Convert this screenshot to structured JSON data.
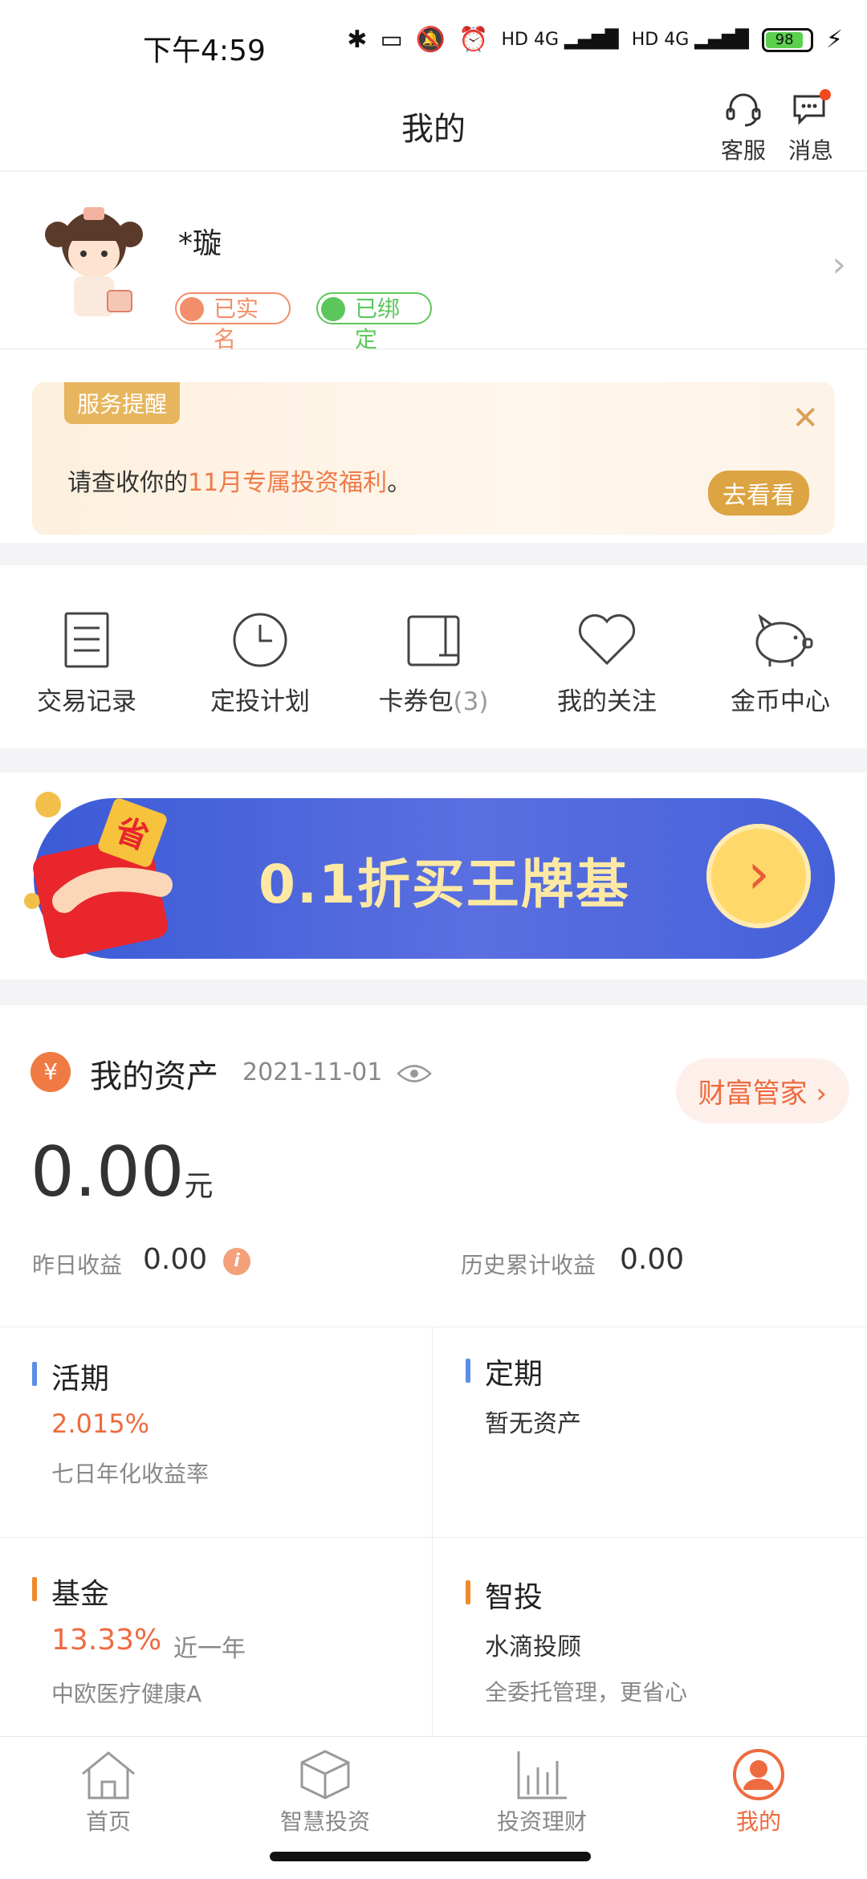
{
  "status_bar": {
    "time": "下午4:59",
    "battery": "98",
    "network": "4G"
  },
  "header": {
    "title": "我的",
    "service_label": "客服",
    "message_label": "消息"
  },
  "profile": {
    "name": "*璇",
    "verified_label": "已实名",
    "wechat_label": "已绑定"
  },
  "service_notice": {
    "tag": "服务提醒",
    "text_prefix": "请查收你的",
    "text_highlight": "11月专属投资福利",
    "text_suffix": "。",
    "button": "去看看"
  },
  "quick_actions": [
    {
      "label": "交易记录",
      "icon": "receipt-icon"
    },
    {
      "label": "定投计划",
      "icon": "clock-icon"
    },
    {
      "label": "卡券包",
      "count": "(3)",
      "icon": "wallet-icon"
    },
    {
      "label": "我的关注",
      "icon": "heart-icon"
    },
    {
      "label": "金币中心",
      "icon": "piggy-bank-icon"
    }
  ],
  "banner": {
    "text": "0.1折买王牌基",
    "badge": "省"
  },
  "assets": {
    "title": "我的资产",
    "date": "2021-11-01",
    "wealth_button": "财富管家",
    "total": "0.00",
    "unit": "元",
    "yesterday_label": "昨日收益",
    "yesterday_value": "0.00",
    "history_label": "历史累计收益",
    "history_value": "0.00",
    "cells": {
      "current": {
        "title": "活期",
        "rate": "2.015%",
        "sub": "七日年化收益率"
      },
      "fixed": {
        "title": "定期",
        "text": "暂无资产"
      },
      "fund": {
        "title": "基金",
        "rate": "13.33%",
        "period": "近一年",
        "sub": "中欧医疗健康A"
      },
      "smart": {
        "title": "智投",
        "text": "水滴投顾",
        "sub": "全委托管理，更省心"
      }
    }
  },
  "bottom_nav": [
    {
      "label": "首页",
      "active": false
    },
    {
      "label": "智慧投资",
      "active": false
    },
    {
      "label": "投资理财",
      "active": false
    },
    {
      "label": "我的",
      "active": true
    }
  ],
  "colors": {
    "accent": "#ee6a3f",
    "gold": "#dca442",
    "banner_blue": "#4561d9"
  }
}
